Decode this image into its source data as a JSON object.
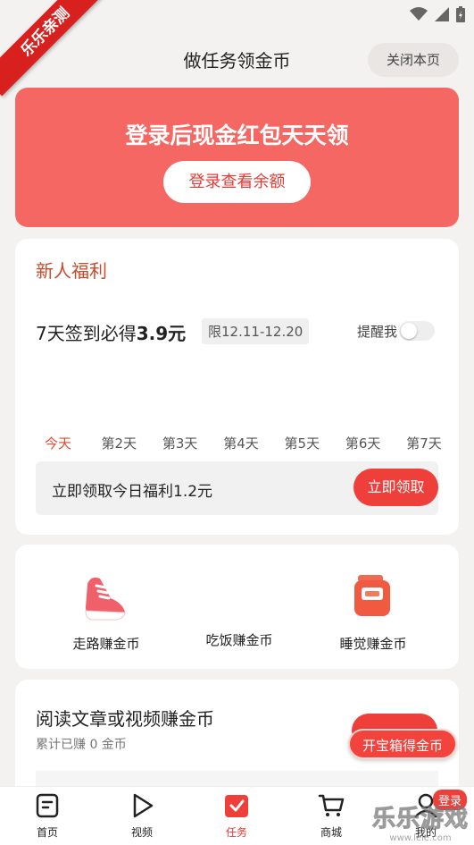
{
  "ribbon": {
    "text": "乐乐亲测"
  },
  "header": {
    "title": "做任务领金币",
    "close_label": "关闭本页"
  },
  "banner": {
    "title": "登录后现金红包天天领",
    "button_label": "登录查看余额"
  },
  "newbie": {
    "title": "新人福利",
    "sign_prefix": "7天签到必得",
    "sign_amount": "3.9元",
    "limit": "限12.11-12.20",
    "remind_label": "提醒我",
    "days": [
      "今天",
      "第2天",
      "第3天",
      "第4天",
      "第5天",
      "第6天",
      "第7天"
    ],
    "claim_text": "立即领取今日福利1.2元",
    "claim_button": "立即领取"
  },
  "earn": {
    "items": [
      {
        "label": "走路赚金币",
        "icon": "shoe-icon"
      },
      {
        "label": "吃饭赚金币",
        "icon": "meal-icon"
      },
      {
        "label": "睡觉赚金币",
        "icon": "alarm-clock-icon"
      }
    ]
  },
  "read": {
    "title": "阅读文章或视频赚金币",
    "subtitle": "累计已赚 0 金币"
  },
  "treasure": {
    "label": "开宝箱得金币"
  },
  "tabbar": {
    "items": [
      {
        "label": "首页",
        "icon": "home-doc-icon"
      },
      {
        "label": "视频",
        "icon": "play-icon"
      },
      {
        "label": "任务",
        "icon": "task-check-icon"
      },
      {
        "label": "商城",
        "icon": "cart-icon"
      },
      {
        "label": "我的",
        "icon": "user-icon"
      }
    ],
    "login_badge": "登录"
  },
  "watermark": {
    "text": "乐乐游戏",
    "url": "www.lele.com"
  },
  "colors": {
    "accent": "#ee3f3b",
    "banner": "#f56763",
    "newbie_title": "#c84a2a"
  }
}
